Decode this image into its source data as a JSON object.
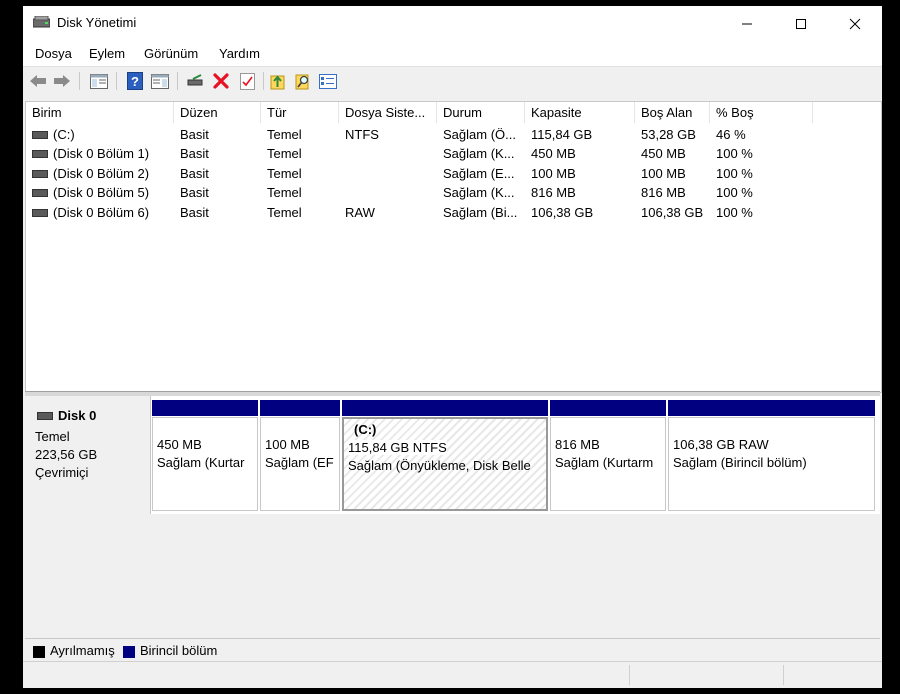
{
  "window": {
    "title": "Disk Yönetimi"
  },
  "menu": [
    "Dosya",
    "Eylem",
    "Görünüm",
    "Yardım"
  ],
  "volumes": {
    "columns": [
      "Birim",
      "Düzen",
      "Tür",
      "Dosya Siste...",
      "Durum",
      "Kapasite",
      "Boş Alan",
      "% Boş"
    ],
    "rows": [
      [
        "(C:)",
        "Basit",
        "Temel",
        "NTFS",
        "Sağlam (Ö...",
        "115,84 GB",
        "53,28 GB",
        "46 %"
      ],
      [
        "(Disk 0 Bölüm 1)",
        "Basit",
        "Temel",
        "",
        "Sağlam (K...",
        "450 MB",
        "450 MB",
        "100 %"
      ],
      [
        "(Disk 0 Bölüm 2)",
        "Basit",
        "Temel",
        "",
        "Sağlam (E...",
        "100 MB",
        "100 MB",
        "100 %"
      ],
      [
        "(Disk 0 Bölüm 5)",
        "Basit",
        "Temel",
        "",
        "Sağlam (K...",
        "816 MB",
        "816 MB",
        "100 %"
      ],
      [
        "(Disk 0 Bölüm 6)",
        "Basit",
        "Temel",
        "RAW",
        "Sağlam (Bi...",
        "106,38 GB",
        "106,38 GB",
        "100 %"
      ]
    ]
  },
  "disk": {
    "name": "Disk 0",
    "type": "Temel",
    "size": "223,56 GB",
    "status": "Çevrimiçi",
    "partitions": [
      {
        "label": "",
        "line1": "450 MB",
        "line2": "Sağlam (Kurtar"
      },
      {
        "label": "",
        "line1": "100 MB",
        "line2": "Sağlam (EF"
      },
      {
        "label": "(C:)",
        "line1": "115,84 GB NTFS",
        "line2": "Sağlam (Önyükleme, Disk Belle"
      },
      {
        "label": "",
        "line1": "816 MB",
        "line2": "Sağlam (Kurtarm"
      },
      {
        "label": "",
        "line1": "106,38 GB RAW",
        "line2": "Sağlam (Birincil bölüm)"
      }
    ]
  },
  "legend": [
    {
      "label": "Ayrılmamış",
      "color": "#000000"
    },
    {
      "label": "Birincil bölüm",
      "color": "#000080"
    }
  ],
  "colors": {
    "partition_bar": "#000080",
    "delete_icon": "#e81123"
  },
  "icons": [
    "back-icon",
    "forward-icon",
    "console-tree-icon",
    "help-icon",
    "properties-icon",
    "connect-icon",
    "delete-icon",
    "checklist-icon",
    "export-icon",
    "search-icon",
    "settings-list-icon"
  ]
}
